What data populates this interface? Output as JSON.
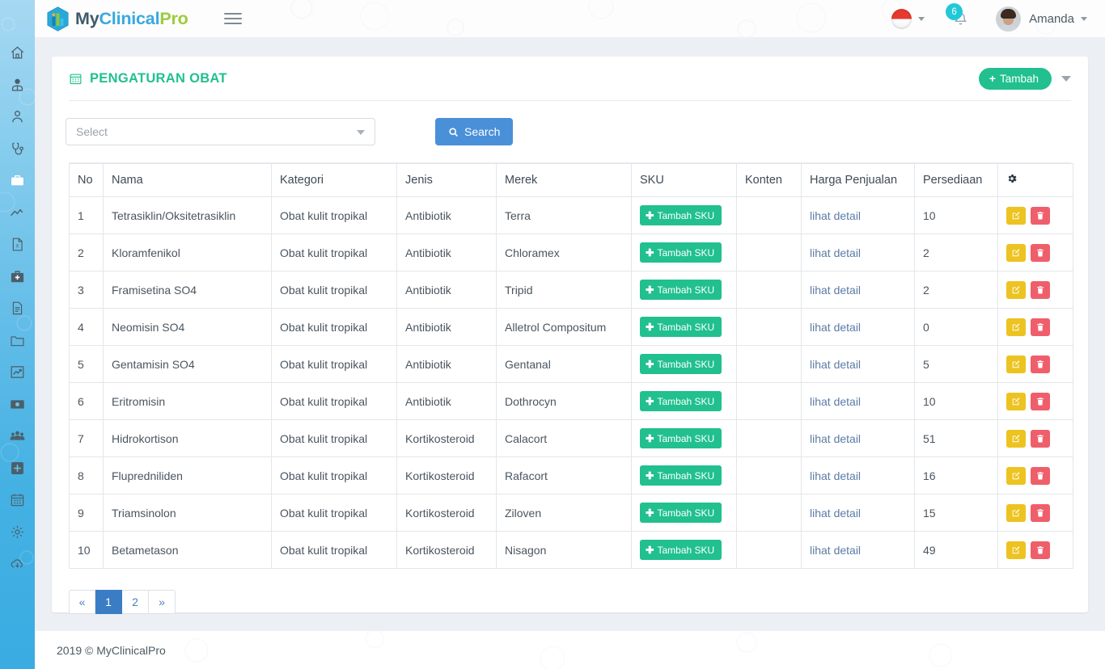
{
  "brand": {
    "part1": "My",
    "part2": "Clinical",
    "part3": "Pro"
  },
  "header": {
    "menu_toggle": "hamburger-menu",
    "language_flag": "indonesia-flag",
    "notification_count": "6",
    "username": "Amanda"
  },
  "sidebar": {
    "items": [
      {
        "name": "home",
        "icon": "home-icon",
        "active": false
      },
      {
        "name": "doctor",
        "icon": "doctor-icon",
        "active": false
      },
      {
        "name": "patient",
        "icon": "user-icon",
        "active": false
      },
      {
        "name": "stethoscope",
        "icon": "stethoscope-icon",
        "active": false
      },
      {
        "name": "pharmacy",
        "icon": "briefcase-icon",
        "active": true
      },
      {
        "name": "statistics",
        "icon": "chart-line-icon",
        "active": false
      },
      {
        "name": "excel-report",
        "icon": "excel-file-icon",
        "active": false
      },
      {
        "name": "medical-kit",
        "icon": "medical-kit-icon",
        "active": false
      },
      {
        "name": "documents",
        "icon": "document-icon",
        "active": false
      },
      {
        "name": "folders",
        "icon": "folder-icon",
        "active": false
      },
      {
        "name": "growth",
        "icon": "chart-growth-icon",
        "active": false
      },
      {
        "name": "billing",
        "icon": "money-icon",
        "active": false
      },
      {
        "name": "staff",
        "icon": "users-group-icon",
        "active": false
      },
      {
        "name": "add",
        "icon": "plus-square-icon",
        "active": false
      },
      {
        "name": "schedule",
        "icon": "calendar-icon",
        "active": false
      },
      {
        "name": "settings",
        "icon": "gear-icon",
        "active": false
      },
      {
        "name": "backup",
        "icon": "cloud-download-icon",
        "active": false
      }
    ]
  },
  "page": {
    "title": "PENGATURAN OBAT",
    "title_icon": "calendar-grid-icon",
    "add_button": "Tambah",
    "add_button_icon": "plus-icon",
    "add_dropdown_icon": "chevron-down-icon"
  },
  "filter": {
    "select_placeholder": "Select",
    "select_value": "",
    "search_button": "Search",
    "search_icon": "search-icon"
  },
  "table": {
    "columns": [
      "No",
      "Nama",
      "Kategori",
      "Jenis",
      "Merek",
      "SKU",
      "Konten",
      "Harga Penjualan",
      "Persediaan"
    ],
    "settings_icon": "gear-icon",
    "sku_button_label": "Tambah SKU",
    "detail_link_label": "lihat detail",
    "edit_icon": "edit-icon",
    "delete_icon": "trash-icon",
    "rows": [
      {
        "no": "1",
        "nama": "Tetrasiklin/Oksitetrasiklin",
        "kategori": "Obat kulit tropikal",
        "jenis": "Antibiotik",
        "merek": "Terra",
        "persediaan": "10"
      },
      {
        "no": "2",
        "nama": "Kloramfenikol",
        "kategori": "Obat kulit tropikal",
        "jenis": "Antibiotik",
        "merek": "Chloramex",
        "persediaan": "2"
      },
      {
        "no": "3",
        "nama": "Framisetina SO4",
        "kategori": "Obat kulit tropikal",
        "jenis": "Antibiotik",
        "merek": "Tripid",
        "persediaan": "2"
      },
      {
        "no": "4",
        "nama": "Neomisin SO4",
        "kategori": "Obat kulit tropikal",
        "jenis": "Antibiotik",
        "merek": "Alletrol Compositum",
        "persediaan": "0"
      },
      {
        "no": "5",
        "nama": "Gentamisin SO4",
        "kategori": "Obat kulit tropikal",
        "jenis": "Antibiotik",
        "merek": "Gentanal",
        "persediaan": "5"
      },
      {
        "no": "6",
        "nama": "Eritromisin",
        "kategori": "Obat kulit tropikal",
        "jenis": "Antibiotik",
        "merek": "Dothrocyn",
        "persediaan": "10"
      },
      {
        "no": "7",
        "nama": "Hidrokortison",
        "kategori": "Obat kulit tropikal",
        "jenis": "Kortikosteroid",
        "merek": "Calacort",
        "persediaan": "51"
      },
      {
        "no": "8",
        "nama": "Flupredniliden",
        "kategori": "Obat kulit tropikal",
        "jenis": "Kortikosteroid",
        "merek": "Rafacort",
        "persediaan": "16"
      },
      {
        "no": "9",
        "nama": "Triamsinolon",
        "kategori": "Obat kulit tropikal",
        "jenis": "Kortikosteroid",
        "merek": "Ziloven",
        "persediaan": "15"
      },
      {
        "no": "10",
        "nama": "Betametason",
        "kategori": "Obat kulit tropikal",
        "jenis": "Kortikosteroid",
        "merek": "Nisagon",
        "persediaan": "49"
      }
    ]
  },
  "pagination": {
    "prev": "«",
    "pages": [
      "1",
      "2"
    ],
    "next": "»",
    "active": "1"
  },
  "footer": {
    "copyright": "2019 © MyClinicalPro"
  },
  "colors": {
    "accent_teal": "#21c08e",
    "accent_blue": "#4a90d9",
    "sidebar_blue": "#5cbbe6",
    "edit_yellow": "#edc321",
    "delete_red": "#ef5f6b",
    "link_blue": "#5b7ba6",
    "badge_teal": "#22c8d8"
  }
}
